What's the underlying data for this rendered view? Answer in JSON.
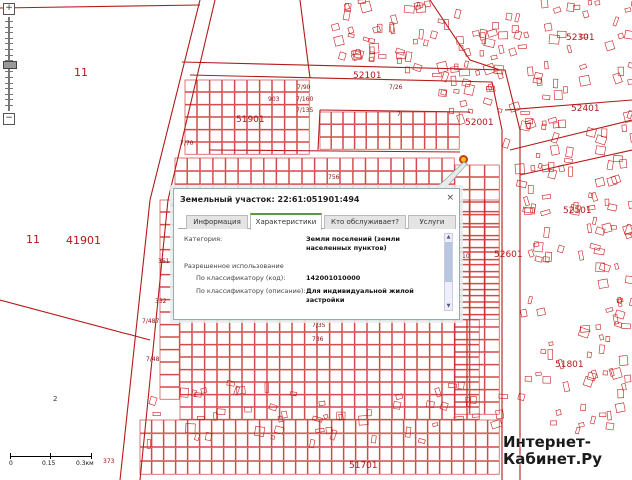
{
  "map": {
    "zones": [
      "11",
      "41901",
      "51901",
      "52101",
      "52301",
      "52001",
      "52401",
      "52501",
      "52601",
      "51801",
      "51701",
      "2"
    ],
    "street_labels": [
      "7/90",
      "7/160",
      "903",
      "7/135",
      "7/26",
      "756",
      "7",
      "403",
      "351",
      "352",
      "7/487",
      "7/48",
      "736",
      "7/35",
      "373",
      "10",
      "7/70"
    ]
  },
  "zoom": {
    "plus": "+",
    "minus": "−"
  },
  "popup": {
    "title": "Земельный участок: 22:61:051901:494",
    "close": "×",
    "tabs": [
      "Информация",
      "Характеристики",
      "Кто обслуживает?",
      "Услуги"
    ],
    "category_label": "Категория:",
    "category_value": "Земли поселений (земли населенных пунктов)",
    "permitted_use_header": "Разрешенное использование",
    "code_label": "По классификатору (код):",
    "code_value": "142001010000",
    "desc_label": "По классификатору (описание):",
    "desc_value": "Для индивидуальной жилой застройки"
  },
  "scale": {
    "t0": "0",
    "t1": "0.15",
    "t2": "0.3км"
  },
  "watermark": {
    "line1": "Интернет-",
    "line2": "Кабинет.Ру"
  },
  "colors": {
    "parcel": "#c81e1e",
    "road": "#b51a1a",
    "tab_active": "#5a9a42"
  }
}
